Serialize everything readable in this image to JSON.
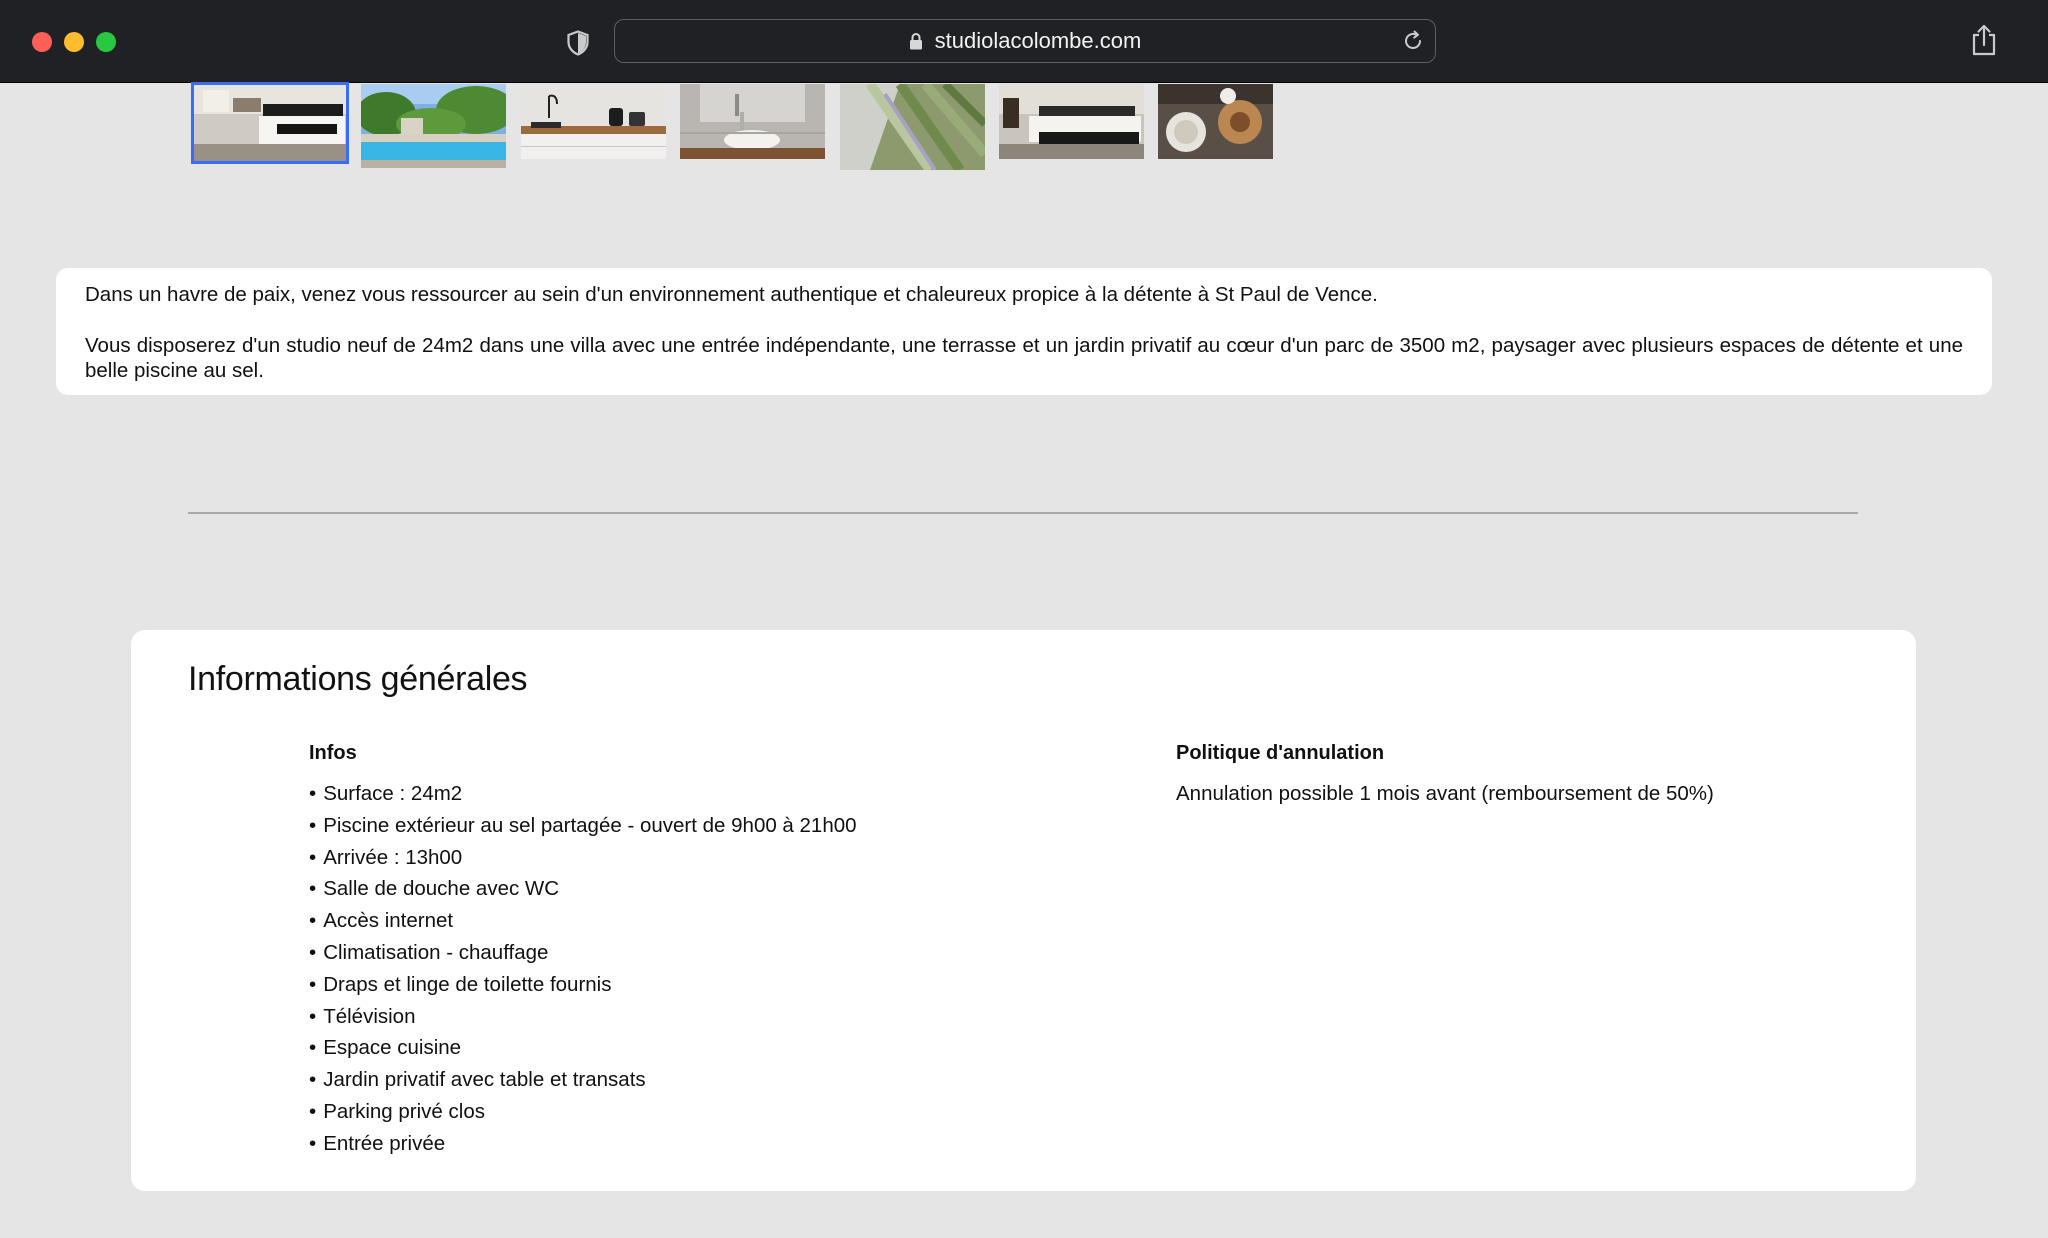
{
  "browser": {
    "url": "studiolacolombe.com"
  },
  "gallery": {
    "thumbnails": [
      {
        "alt": "bedroom",
        "selected": true
      },
      {
        "alt": "pool",
        "selected": false
      },
      {
        "alt": "kitchen",
        "selected": false
      },
      {
        "alt": "bathroom",
        "selected": false
      },
      {
        "alt": "lavender",
        "selected": false
      },
      {
        "alt": "bedroom-2",
        "selected": false
      },
      {
        "alt": "table",
        "selected": false
      }
    ]
  },
  "description": {
    "paragraph1": "Dans un havre de paix, venez vous ressourcer au sein d'un environnement authentique et chaleureux propice à la détente à St Paul de Vence.",
    "paragraph2": "Vous disposerez d'un studio neuf de 24m2 dans une villa avec une entrée indépendante, une terrasse et un jardin privatif au cœur d'un parc de 3500 m2, paysager avec plusieurs espaces de détente et une belle piscine au sel."
  },
  "info": {
    "title": "Informations générales",
    "infos_heading": "Infos",
    "items": [
      "Surface : 24m2",
      "Piscine extérieur au sel partagée - ouvert de 9h00 à 21h00",
      "Arrivée : 13h00",
      "Salle de douche avec WC",
      "Accès internet",
      "Climatisation - chauffage",
      "Draps et linge de toilette fournis",
      "Télévision",
      "Espace cuisine",
      "Jardin privatif avec table et transats",
      "Parking privé clos",
      "Entrée privée"
    ],
    "policy_heading": "Politique d'annulation",
    "policy_text": "Annulation possible 1 mois avant (remboursement de 50%)"
  },
  "colors": {
    "chrome": "#1f2124",
    "page_background": "#e5e5e5",
    "selection_outline": "#3b6cf6"
  }
}
